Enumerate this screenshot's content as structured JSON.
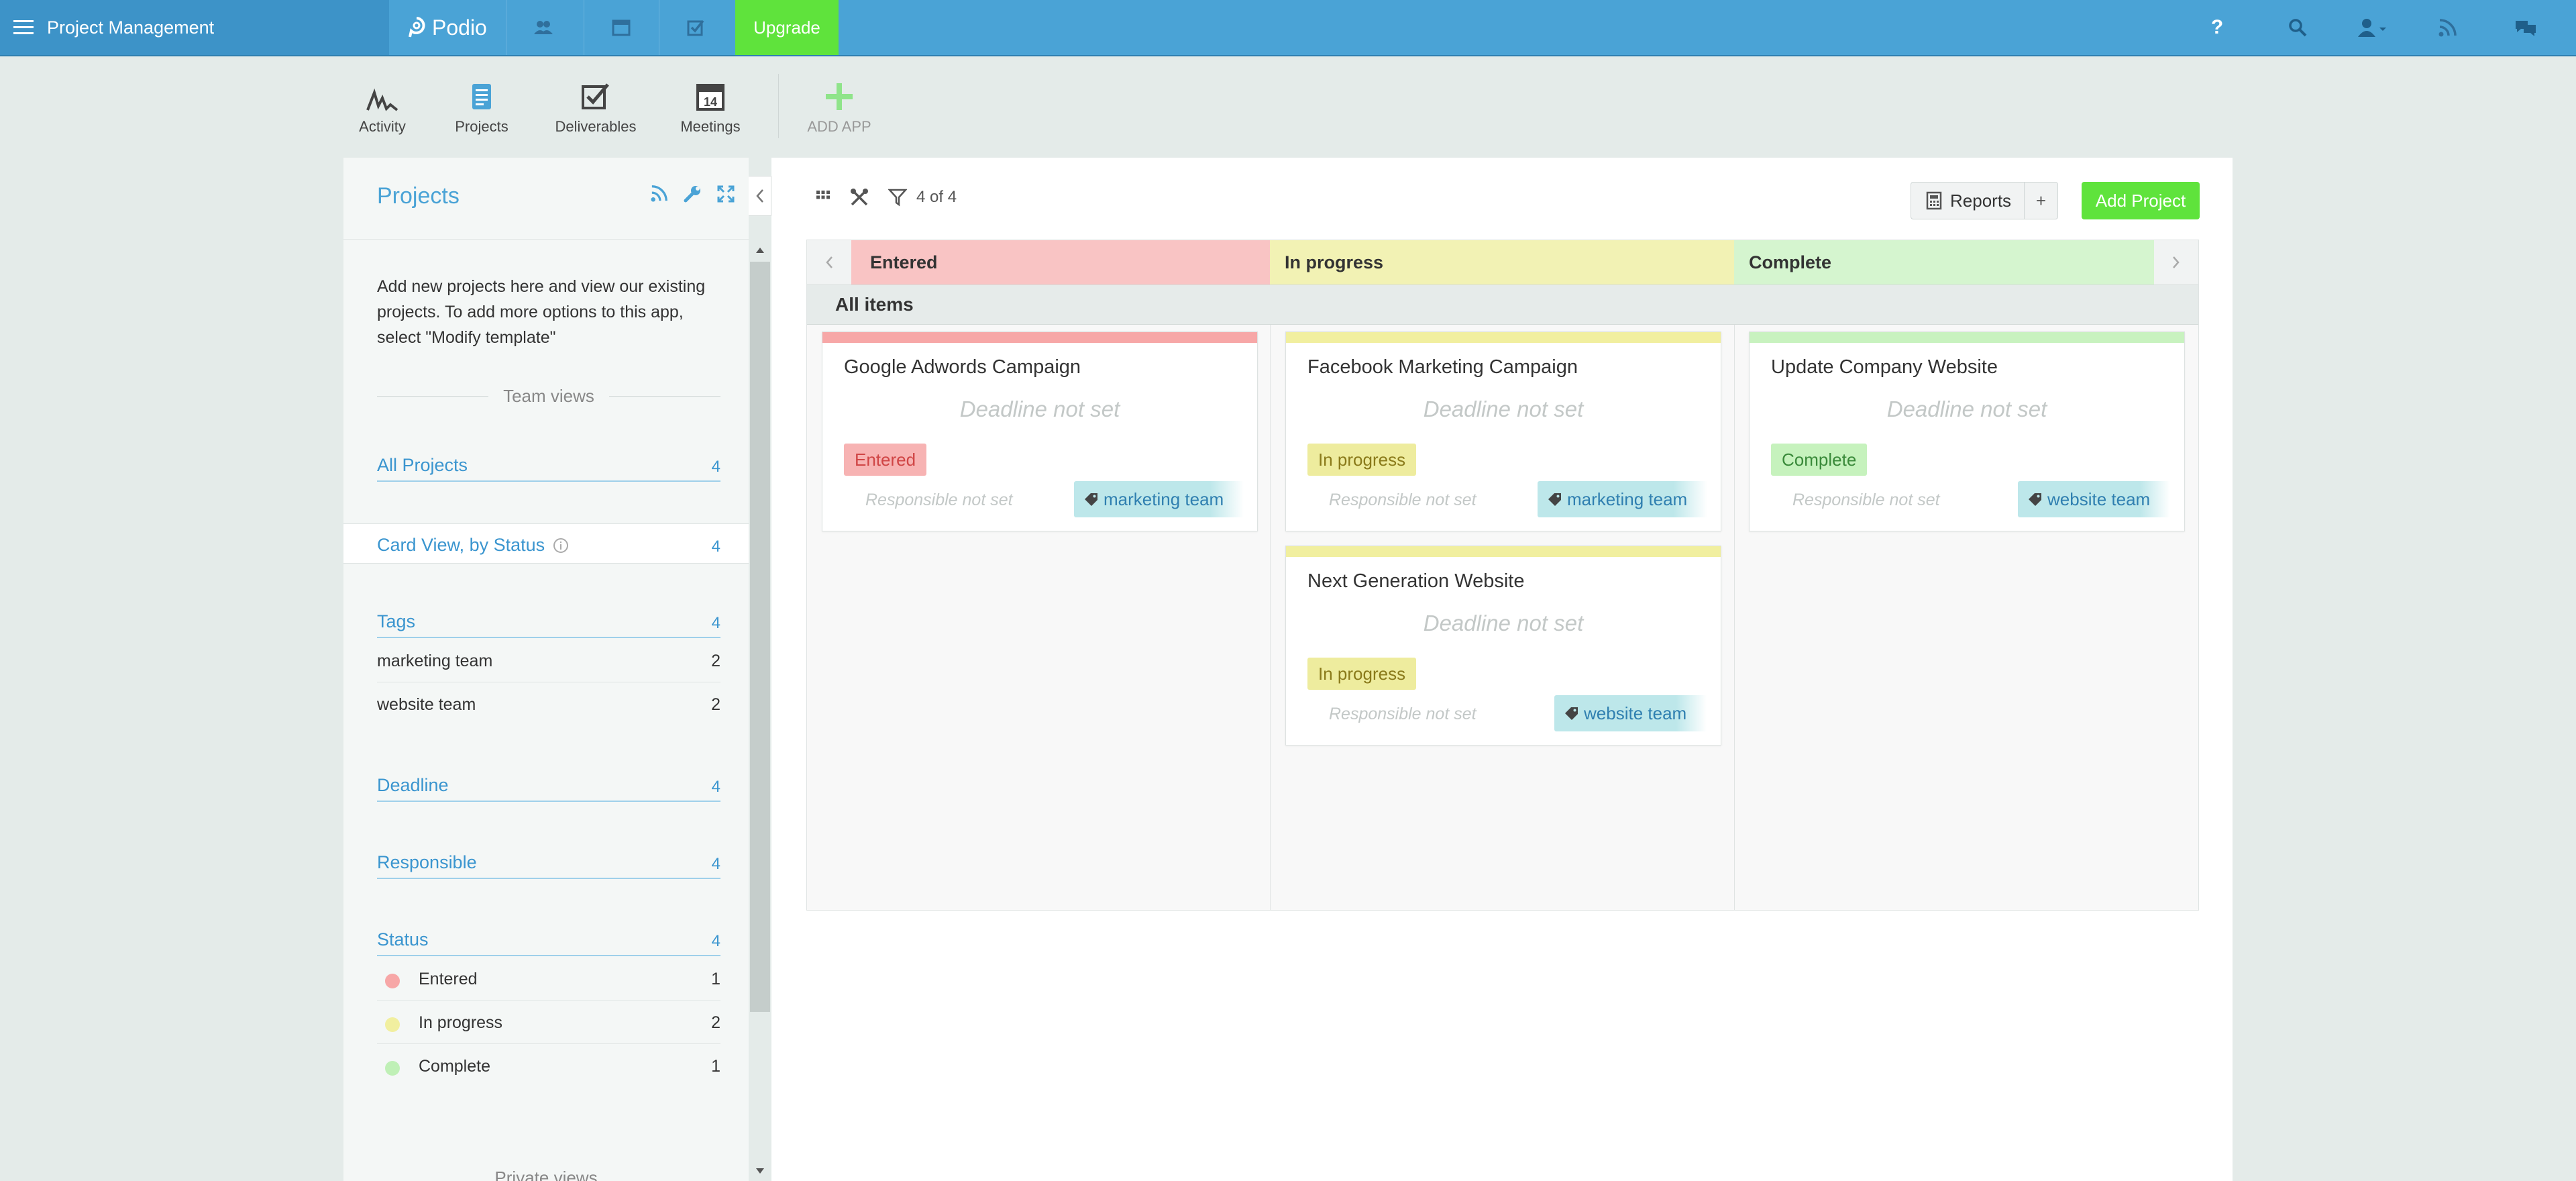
{
  "topbar": {
    "workspace": "Project Management",
    "logo": "Podio",
    "upgrade_label": "Upgrade",
    "help_label": "?",
    "colors": {
      "bar": "#4aa3d6",
      "workspace_bg": "#3d93c8",
      "upgrade": "#5fe33c"
    }
  },
  "apps": [
    {
      "label": "Activity",
      "icon": "activity-icon"
    },
    {
      "label": "Projects",
      "icon": "projects-icon"
    },
    {
      "label": "Deliverables",
      "icon": "deliverables-icon"
    },
    {
      "label": "Meetings",
      "icon": "meetings-icon",
      "day": "14"
    },
    {
      "label": "ADD APP",
      "icon": "add-app-icon"
    }
  ],
  "sidebar": {
    "title": "Projects",
    "description": "Add new projects here and view our existing projects. To add more options to this app, select \"Modify template\"",
    "team_views_label": "Team views",
    "all_projects": {
      "label": "All Projects",
      "count": "4"
    },
    "card_view": {
      "label": "Card View, by Status",
      "count": "4"
    },
    "tags": {
      "label": "Tags",
      "count": "4",
      "items": [
        {
          "label": "marketing team",
          "count": "2"
        },
        {
          "label": "website team",
          "count": "2"
        }
      ]
    },
    "deadline": {
      "label": "Deadline",
      "count": "4"
    },
    "responsible": {
      "label": "Responsible",
      "count": "4"
    },
    "status": {
      "label": "Status",
      "count": "4",
      "items": [
        {
          "label": "Entered",
          "count": "1",
          "color": "#f7a7a7"
        },
        {
          "label": "In progress",
          "count": "2",
          "color": "#f1ef9f"
        },
        {
          "label": "Complete",
          "count": "1",
          "color": "#bff0b6"
        }
      ]
    },
    "private_views_label": "Private views"
  },
  "main": {
    "filter_count": "4 of 4",
    "reports_label": "Reports",
    "reports_plus": "+",
    "add_project_label": "Add Project",
    "group_label": "All items",
    "columns": [
      {
        "label": "Entered",
        "color": "#f9c4c4"
      },
      {
        "label": "In progress",
        "color": "#f2f2b4"
      },
      {
        "label": "Complete",
        "color": "#d5f5cf"
      }
    ],
    "cards": [
      {
        "title": "Google Adwords Campaign",
        "deadline": "Deadline not set",
        "status": "Entered",
        "responsible": "Responsible not set",
        "tag": "marketing team"
      },
      {
        "title": "Facebook Marketing Campaign",
        "deadline": "Deadline not set",
        "status": "In progress",
        "responsible": "Responsible not set",
        "tag": "marketing team"
      },
      {
        "title": "Next Generation Website",
        "deadline": "Deadline not set",
        "status": "In progress",
        "responsible": "Responsible not set",
        "tag": "website team"
      },
      {
        "title": "Update Company Website",
        "deadline": "Deadline not set",
        "status": "Complete",
        "responsible": "Responsible not set",
        "tag": "website team"
      }
    ]
  }
}
